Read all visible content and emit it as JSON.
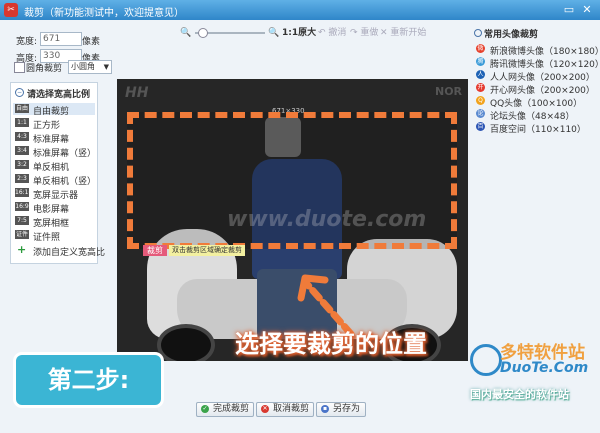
{
  "window": {
    "title": "裁剪（新功能测试中，欢迎提意见）",
    "app_icon": "scissors-app-icon",
    "maximize_glyph": "▭",
    "close_glyph": "✕"
  },
  "size": {
    "width_label": "宽度:",
    "width_value": "671",
    "height_label": "高度:",
    "height_value": "330",
    "unit": "像素",
    "round_corner_label": "圆角裁剪",
    "shape_value": "小圆角"
  },
  "ratio": {
    "heading": "请选择宽高比例",
    "items": [
      {
        "icon": "自由",
        "label": "自由裁剪"
      },
      {
        "icon": "1:1",
        "label": "正方形"
      },
      {
        "icon": "4:3",
        "label": "标准屏幕"
      },
      {
        "icon": "3:4",
        "label": "标准屏幕（竖）"
      },
      {
        "icon": "3:2",
        "label": "单反相机"
      },
      {
        "icon": "2:3",
        "label": "单反相机（竖）"
      },
      {
        "icon": "16:10",
        "label": "宽屏显示器"
      },
      {
        "icon": "16:9",
        "label": "电影屏幕"
      },
      {
        "icon": "7:5",
        "label": "宽屏相框"
      },
      {
        "icon": "证件",
        "label": "证件照"
      }
    ],
    "add_custom": "添加自定义宽高比",
    "add_icon": "+"
  },
  "toolbar": {
    "zoom_out": "🔍",
    "zoom_in": "🔍",
    "actual_size": "1:1原大",
    "undo": "撤消",
    "redo": "重做",
    "reset": "重新开始"
  },
  "canvas": {
    "watermark_left": "HH",
    "watermark_right": "NOR",
    "watermark_center": "www.duote.com",
    "crop_size": "671×330",
    "crop_tag": "裁剪",
    "crop_hint": "双击裁剪区域确定裁剪",
    "callout": "选择要裁剪的位置",
    "accent_color": "#f07b3a"
  },
  "presets": {
    "heading": "常用头像裁剪",
    "items": [
      {
        "label": "新浪微博头像（180×180）",
        "color": "#e6402c"
      },
      {
        "label": "腾讯微博头像（120×120）",
        "color": "#3a9bd8"
      },
      {
        "label": "人人网头像（200×200）",
        "color": "#1f63b5"
      },
      {
        "label": "开心网头像（200×200）",
        "color": "#e5392e"
      },
      {
        "label": "QQ头像（100×100）",
        "color": "#f2a31c"
      },
      {
        "label": "论坛头像（48×48）",
        "color": "#5a8ad0"
      },
      {
        "label": "百度空间（110×110）",
        "color": "#2d56b4"
      }
    ]
  },
  "buttons": {
    "finish": "完成裁剪",
    "cancel": "取消裁剪",
    "save_as": "另存为"
  },
  "overlay": {
    "step": "第二步:",
    "site_cn": "多特软件站",
    "site_en": "DuoTe.Com",
    "slogan": "国内最安全的软件站"
  }
}
